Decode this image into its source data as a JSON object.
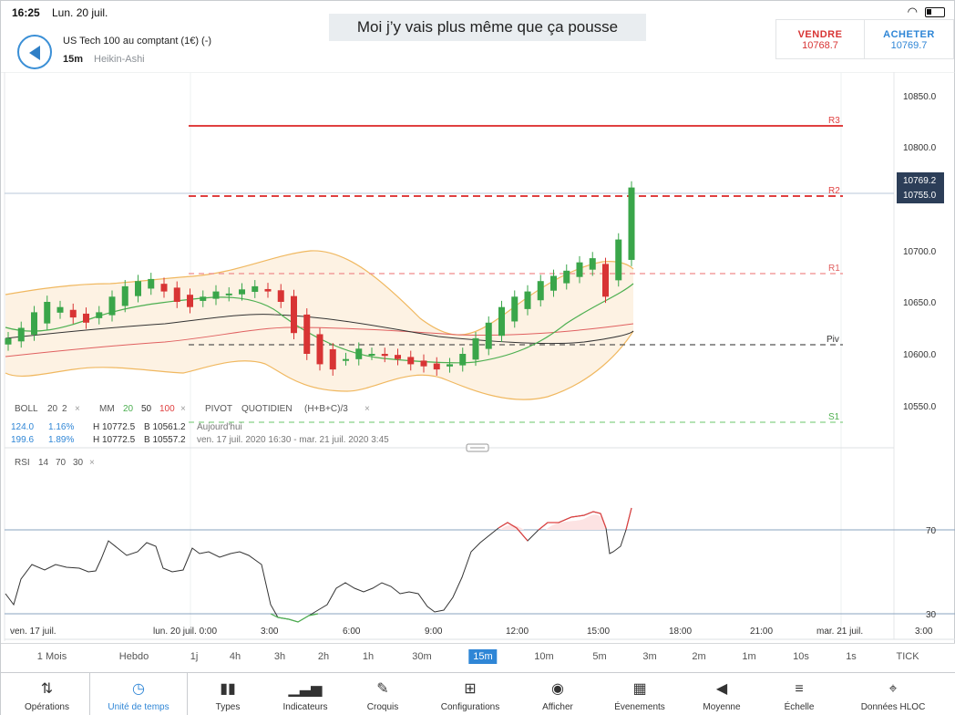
{
  "status": {
    "time": "16:25",
    "date": "Lun. 20 juil."
  },
  "banner": "Moi j’y vais plus même que ça pousse",
  "header": {
    "instrument": "US Tech 100 au comptant (1€) (-)",
    "timeframe": "15m",
    "chart_type": "Heikin-Ashi"
  },
  "trade": {
    "sell_label": "VENDRE",
    "sell_price": "10768.7",
    "buy_label": "ACHETER",
    "buy_price": "10769.7"
  },
  "price_axis": {
    "ticks": [
      "10850.0",
      "10800.0",
      "10700.0",
      "10650.0",
      "10600.0",
      "10550.0"
    ],
    "tag_high": "10769.2",
    "tag_current": "10755.0"
  },
  "levels": {
    "r3": "R3",
    "r2": "R2",
    "r1": "R1",
    "piv": "Piv",
    "s1": "S1"
  },
  "indicators": {
    "boll": {
      "name": "BOLL",
      "p1": "20",
      "p2": "2"
    },
    "mm": {
      "name": "MM",
      "p1": "20",
      "p2": "50",
      "p3": "100"
    },
    "pivot": {
      "name": "PIVOT",
      "p1": "QUOTIDIEN",
      "p2": "(H+B+C)/3"
    },
    "row1": {
      "v": "124.0",
      "pct": "1.16%",
      "h": "H 10772.5",
      "b": "B 10561.2",
      "period": "Aujourd'hui"
    },
    "row2": {
      "v": "199.6",
      "pct": "1.89%",
      "h": "H 10772.5",
      "b": "B 10557.2",
      "period": "ven. 17 juil. 2020 16:30 - mar. 21 juil. 2020 3:45"
    },
    "rsi": {
      "name": "RSI",
      "p1": "14",
      "p2": "70",
      "p3": "30"
    },
    "rsi_levels": [
      "70",
      "30"
    ]
  },
  "close_symbol": "×",
  "time_axis": [
    "ven. 17 juil.",
    "lun. 20 juil. 0:00",
    "3:00",
    "6:00",
    "9:00",
    "12:00",
    "15:00",
    "18:00",
    "21:00",
    "mar. 21 juil.",
    "3:00"
  ],
  "timeframes": [
    "1 Mois",
    "Hebdo",
    "1j",
    "4h",
    "3h",
    "2h",
    "1h",
    "30m",
    "15m",
    "10m",
    "5m",
    "3m",
    "2m",
    "1m",
    "10s",
    "1s",
    "TICK"
  ],
  "active_timeframe": "15m",
  "toolbar": [
    {
      "label": "Opérations",
      "icon": "sort-arrows-icon",
      "glyph": "⇅"
    },
    {
      "label": "Unité de temps",
      "icon": "clock-icon",
      "glyph": "◷"
    },
    {
      "label": "Types",
      "icon": "candles-icon",
      "glyph": "▮▮"
    },
    {
      "label": "Indicateurs",
      "icon": "bar-chart-icon",
      "glyph": "▁▃▅"
    },
    {
      "label": "Croquis",
      "icon": "pencil-icon",
      "glyph": "✎"
    },
    {
      "label": "Configurations",
      "icon": "layout-icon",
      "glyph": "⊞"
    },
    {
      "label": "Afficher",
      "icon": "eye-icon",
      "glyph": "◉"
    },
    {
      "label": "Évenements",
      "icon": "calendar-icon",
      "glyph": "▦"
    },
    {
      "label": "Moyenne",
      "icon": "speaker-icon",
      "glyph": "◀"
    },
    {
      "label": "Échelle",
      "icon": "scale-icon",
      "glyph": "≡"
    },
    {
      "label": "Données HLOC",
      "icon": "crosshair-icon",
      "glyph": "⌖"
    }
  ],
  "active_tool": "Unité de temps",
  "chart_data": {
    "type": "candlestick",
    "series_price_close": [
      10615,
      10625,
      10640,
      10650,
      10645,
      10635,
      10630,
      10640,
      10655,
      10665,
      10670,
      10672,
      10660,
      10650,
      10645,
      10655,
      10660,
      10658,
      10662,
      10665,
      10660,
      10650,
      10620,
      10600,
      10590,
      10585,
      10595,
      10605,
      10600,
      10598,
      10595,
      10590,
      10588,
      10585,
      10590,
      10600,
      10615,
      10630,
      10645,
      10655,
      10660,
      10670,
      10675,
      10680,
      10688,
      10692,
      10655,
      10710,
      10760
    ],
    "pivots": {
      "R3": 10822,
      "R2": 10755,
      "R1": 10678,
      "Piv": 10610,
      "S1": 10535
    },
    "rsi": [
      45,
      50,
      55,
      54,
      53,
      52,
      56,
      58,
      62,
      64,
      60,
      52,
      50,
      55,
      58,
      60,
      50,
      47,
      44,
      38,
      34,
      36,
      42,
      46,
      48,
      40,
      35,
      33,
      45,
      55,
      62,
      68,
      72,
      68,
      64,
      70,
      72,
      74,
      66,
      72
    ]
  }
}
